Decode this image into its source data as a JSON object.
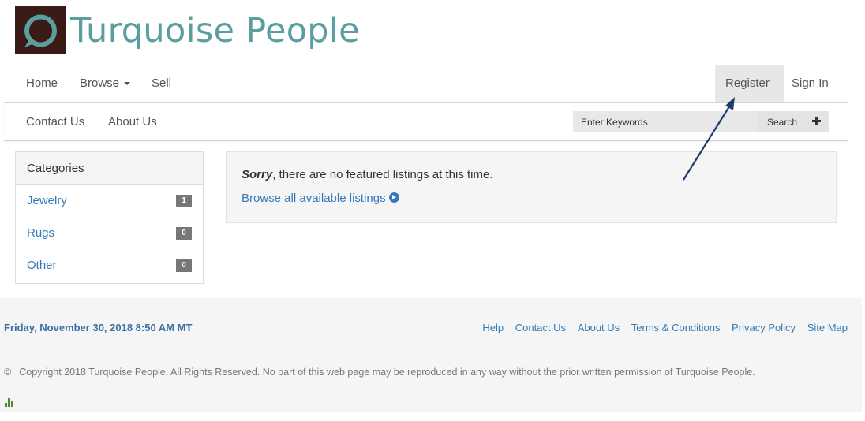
{
  "brand": {
    "name": "Turquoise People",
    "logo_color": "#3a1a14",
    "text_color": "#5b9ea0"
  },
  "nav_primary": {
    "home": "Home",
    "browse": "Browse",
    "sell": "Sell",
    "register": "Register",
    "sign_in": "Sign In"
  },
  "nav_secondary": {
    "contact": "Contact Us",
    "about": "About Us"
  },
  "search": {
    "placeholder": "Enter Keywords",
    "value": "",
    "button_label": "Search",
    "button_icon": "plus-icon"
  },
  "categories": {
    "title": "Categories",
    "items": [
      {
        "label": "Jewelry",
        "count": "1"
      },
      {
        "label": "Rugs",
        "count": "0"
      },
      {
        "label": "Other",
        "count": "0"
      }
    ]
  },
  "featured": {
    "sorry": "Sorry",
    "message": ", there are no featured listings at this time.",
    "browse_link": "Browse all available listings",
    "browse_icon": "arrow-circle-right-icon"
  },
  "footer": {
    "date": "Friday, November 30, 2018 8:50 AM MT",
    "links": [
      "Help",
      "Contact Us",
      "About Us",
      "Terms & Conditions",
      "Privacy Policy",
      "Site Map"
    ],
    "copyright_symbol": "©",
    "copyright": "Copyright 2018 Turquoise People. All Rights Reserved. No part of this web page may be reproduced in any way without the prior written permission of Turquoise People.",
    "stats_icon": "bar-chart-icon"
  },
  "colors": {
    "link": "#337ab7",
    "annotation_arrow": "#1e3a6e",
    "badge": "#777777"
  }
}
